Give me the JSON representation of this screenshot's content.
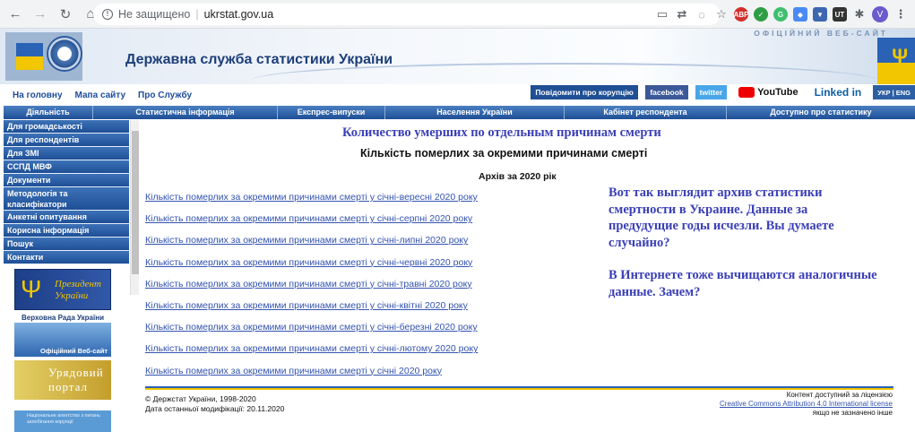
{
  "browser": {
    "insecure_label": "Не защищено",
    "url": "ukrstat.gov.ua",
    "profile_initial": "V",
    "ext_abp": "ABP",
    "ext_ut": "UT"
  },
  "header": {
    "official_label": "ОФІЦІЙНИЙ ВЕБ-САЙТ",
    "site_title": "Державна служба статистики України"
  },
  "topnav": {
    "home": "На головну",
    "sitemap": "Мапа сайту",
    "about": "Про Службу"
  },
  "social": {
    "corruption": "Повідомити про корупцію",
    "facebook": "facebook",
    "twitter": "twitter",
    "youtube": "YouTube",
    "linkedin": "Linked in",
    "lang": "УКР | ENG"
  },
  "mainmenu": [
    "Діяльність",
    "Статистична інформація",
    "Експрес-випуски",
    "Населення України",
    "Кабінет респондента",
    "Доступно про статистику"
  ],
  "sidebar": {
    "items": [
      "Для громадськості",
      "Для респондентів",
      "Для ЗМІ",
      "ССПД МВФ",
      "Документи",
      "Методологія та класифікатори",
      "Анкетні опитування",
      "Корисна інформація",
      "Пошук",
      "Контакти"
    ],
    "banner_president": "Президент України",
    "banner_rada_top": "Верховна Рада України",
    "banner_rada_bottom": "Офіційний Веб-сайт",
    "banner_gov": "Урядовий портал",
    "banner_nazk": "Національне агентство з питань запобігання корупції"
  },
  "content": {
    "heading_ru": "Количество умерших по отдельным причинам смерти",
    "heading_ua": "Кількість померлих за окремими причинами смерті",
    "archive": "Архів за 2020 рік",
    "links": [
      "Кількість померлих за окремими причинами смерті у січні-вересні 2020 року",
      "Кількість померлих за окремими причинами смерті у січні-серпні 2020 року",
      "Кількість померлих за окремими причинами смерті у січні-липні 2020 року",
      "Кількість померлих за окремими причинами смерті у січні-червні 2020 року",
      "Кількість померлих за окремими причинами смерті у січні-травні 2020 року",
      "Кількість померлих за окремими причинами смерті у січні-квітні 2020 року",
      "Кількість померлих за окремими причинами смерті у січні-березні 2020 року",
      "Кількість померлих за окремими причинами смерті у січні-лютому 2020 року",
      "Кількість померлих за окремими причинами смерті у січні 2020 року"
    ],
    "comment_p1": "Вот так выглядит архив статистики смертности в Украине. Данные за предудущие годы исчезли. Вы думаете случайно?",
    "comment_p2": "В Интернете тоже вычищаются аналогичные данные. Зачем?"
  },
  "footer": {
    "copyright": "© Держстат України, 1998-2020",
    "modified": "Дата останньої модифікації: 20.11.2020",
    "license_1": "Контент доступний за ліцензією",
    "license_link": "Creative Commons Attribution 4.0 International license",
    "license_3": "якщо не зазначено інше"
  },
  "colors": {
    "menu_blue": "#1e4f96",
    "link_blue": "#3353b0",
    "comment_blue": "#3a3fb6",
    "flag_blue": "#2a62b5",
    "flag_yellow": "#f2c600"
  }
}
